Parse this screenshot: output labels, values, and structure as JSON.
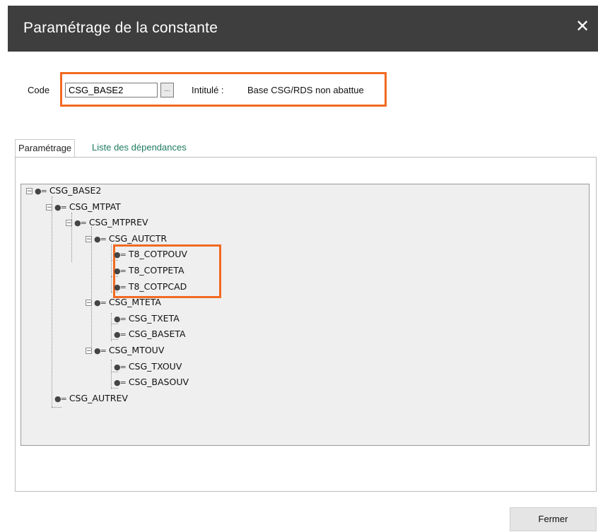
{
  "dialog": {
    "title": "Paramétrage de la constante",
    "close_glyph": "✕"
  },
  "form": {
    "code_label": "Code",
    "code_value": "CSG_BASE2",
    "browse_label": "...",
    "intitule_label": "Intitulé :",
    "intitule_value": "Base CSG/RDS non abattue"
  },
  "tabs": [
    {
      "label": "Paramétrage",
      "active": true
    },
    {
      "label": "Liste des dépendances",
      "active": false
    }
  ],
  "tree": {
    "node_icon": "●=",
    "expander_glyph": "−",
    "nodes": [
      {
        "label": "CSG_BASE2",
        "depth": 0,
        "expandable": true
      },
      {
        "label": "CSG_MTPAT",
        "depth": 1,
        "expandable": true
      },
      {
        "label": "CSG_MTPREV",
        "depth": 2,
        "expandable": true
      },
      {
        "label": "CSG_AUTCTR",
        "depth": 3,
        "expandable": true
      },
      {
        "label": "T8_COTPOUV",
        "depth": 4,
        "expandable": false
      },
      {
        "label": "T8_COTPETA",
        "depth": 4,
        "expandable": false
      },
      {
        "label": "T8_COTPCAD",
        "depth": 4,
        "expandable": false
      },
      {
        "label": "CSG_MTETA",
        "depth": 3,
        "expandable": true
      },
      {
        "label": "CSG_TXETA",
        "depth": 4,
        "expandable": false
      },
      {
        "label": "CSG_BASETA",
        "depth": 4,
        "expandable": false
      },
      {
        "label": "CSG_MTOUV",
        "depth": 3,
        "expandable": true
      },
      {
        "label": "CSG_TXOUV",
        "depth": 4,
        "expandable": false
      },
      {
        "label": "CSG_BASOUV",
        "depth": 4,
        "expandable": false
      },
      {
        "label": "CSG_AUTREV",
        "depth": 1,
        "expandable": false
      }
    ]
  },
  "footer": {
    "close_button_label": "Fermer"
  },
  "colors": {
    "titlebar": "#3e3e3e",
    "highlight": "#f26a21",
    "tree_background": "#efefef",
    "inactive_tab_text": "#1c7a5e"
  },
  "icons": {
    "close": "close-icon",
    "browse": "ellipsis-icon",
    "expander": "collapse-icon",
    "node": "constant-node-icon"
  }
}
